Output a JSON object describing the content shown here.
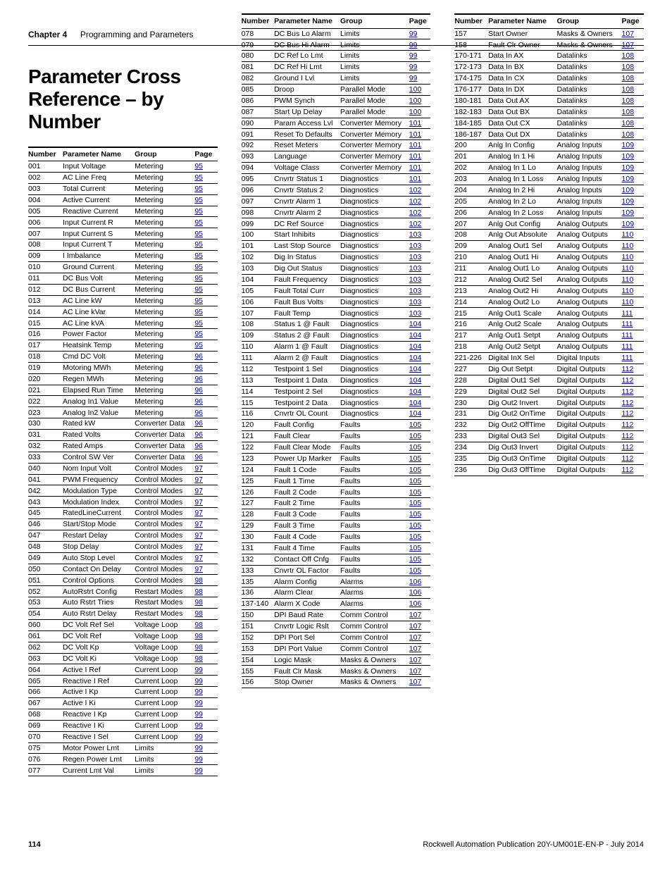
{
  "header": {
    "chapter_label": "Chapter 4",
    "chapter_title": "Programming and Parameters"
  },
  "page_title": "Parameter Cross Reference – by Number",
  "table_headers": [
    "Number",
    "Parameter Name",
    "Group",
    "Page"
  ],
  "columns": [
    [
      {
        "n": "001",
        "p": "Input Voltage",
        "g": "Metering",
        "pg": "95"
      },
      {
        "n": "002",
        "p": "AC Line Freq",
        "g": "Metering",
        "pg": "95"
      },
      {
        "n": "003",
        "p": "Total Current",
        "g": "Metering",
        "pg": "95"
      },
      {
        "n": "004",
        "p": "Active Current",
        "g": "Metering",
        "pg": "95"
      },
      {
        "n": "005",
        "p": "Reactive Current",
        "g": "Metering",
        "pg": "95"
      },
      {
        "n": "006",
        "p": "Input Current R",
        "g": "Metering",
        "pg": "95"
      },
      {
        "n": "007",
        "p": "Input Current S",
        "g": "Metering",
        "pg": "95"
      },
      {
        "n": "008",
        "p": "Input Current T",
        "g": "Metering",
        "pg": "95"
      },
      {
        "n": "009",
        "p": "I Imbalance",
        "g": "Metering",
        "pg": "95"
      },
      {
        "n": "010",
        "p": "Ground Current",
        "g": "Metering",
        "pg": "95"
      },
      {
        "n": "011",
        "p": "DC Bus Volt",
        "g": "Metering",
        "pg": "95"
      },
      {
        "n": "012",
        "p": "DC Bus Current",
        "g": "Metering",
        "pg": "95"
      },
      {
        "n": "013",
        "p": "AC Line kW",
        "g": "Metering",
        "pg": "95"
      },
      {
        "n": "014",
        "p": "AC Line kVar",
        "g": "Metering",
        "pg": "95"
      },
      {
        "n": "015",
        "p": "AC Line kVA",
        "g": "Metering",
        "pg": "95"
      },
      {
        "n": "016",
        "p": "Power Factor",
        "g": "Metering",
        "pg": "95"
      },
      {
        "n": "017",
        "p": "Heatsink Temp",
        "g": "Metering",
        "pg": "95"
      },
      {
        "n": "018",
        "p": "Cmd DC Volt",
        "g": "Metering",
        "pg": "96"
      },
      {
        "n": "019",
        "p": "Motoring MWh",
        "g": "Metering",
        "pg": "96"
      },
      {
        "n": "020",
        "p": "Regen MWh",
        "g": "Metering",
        "pg": "96"
      },
      {
        "n": "021",
        "p": "Elapsed Run Time",
        "g": "Metering",
        "pg": "96"
      },
      {
        "n": "022",
        "p": "Analog In1 Value",
        "g": "Metering",
        "pg": "96"
      },
      {
        "n": "023",
        "p": "Analog In2 Value",
        "g": "Metering",
        "pg": "96"
      },
      {
        "n": "030",
        "p": "Rated kW",
        "g": "Converter Data",
        "pg": "96"
      },
      {
        "n": "031",
        "p": "Rated Volts",
        "g": "Converter Data",
        "pg": "96"
      },
      {
        "n": "032",
        "p": "Rated Amps",
        "g": "Converter Data",
        "pg": "96"
      },
      {
        "n": "033",
        "p": "Control SW Ver",
        "g": "Converter Data",
        "pg": "96"
      },
      {
        "n": "040",
        "p": "Nom Input Volt",
        "g": "Control Modes",
        "pg": "97"
      },
      {
        "n": "041",
        "p": "PWM Frequency",
        "g": "Control Modes",
        "pg": "97"
      },
      {
        "n": "042",
        "p": "Modulation Type",
        "g": "Control Modes",
        "pg": "97"
      },
      {
        "n": "043",
        "p": "Modulation Index",
        "g": "Control Modes",
        "pg": "97"
      },
      {
        "n": "045",
        "p": "RatedLineCurrent",
        "g": "Control Modes",
        "pg": "97"
      },
      {
        "n": "046",
        "p": "Start/Stop Mode",
        "g": "Control Modes",
        "pg": "97"
      },
      {
        "n": "047",
        "p": "Restart Delay",
        "g": "Control Modes",
        "pg": "97"
      },
      {
        "n": "048",
        "p": "Stop Delay",
        "g": "Control Modes",
        "pg": "97"
      },
      {
        "n": "049",
        "p": "Auto Stop Level",
        "g": "Control Modes",
        "pg": "97"
      },
      {
        "n": "050",
        "p": "Contact On Delay",
        "g": "Control Modes",
        "pg": "97"
      },
      {
        "n": "051",
        "p": "Control Options",
        "g": "Control Modes",
        "pg": "98"
      },
      {
        "n": "052",
        "p": "AutoRstrt Config",
        "g": "Restart Modes",
        "pg": "98"
      },
      {
        "n": "053",
        "p": "Auto Rstrt Tries",
        "g": "Restart Modes",
        "pg": "98"
      },
      {
        "n": "054",
        "p": "Auto Rstrt Delay",
        "g": "Restart Modes",
        "pg": "98"
      },
      {
        "n": "060",
        "p": "DC Volt Ref Sel",
        "g": "Voltage Loop",
        "pg": "98"
      },
      {
        "n": "061",
        "p": "DC Volt Ref",
        "g": "Voltage Loop",
        "pg": "98"
      },
      {
        "n": "062",
        "p": "DC Volt Kp",
        "g": "Voltage Loop",
        "pg": "98"
      },
      {
        "n": "063",
        "p": "DC Volt Ki",
        "g": "Voltage Loop",
        "pg": "98"
      },
      {
        "n": "064",
        "p": "Active I Ref",
        "g": "Current Loop",
        "pg": "99"
      },
      {
        "n": "065",
        "p": "Reactive I Ref",
        "g": "Current Loop",
        "pg": "99"
      },
      {
        "n": "066",
        "p": "Active I Kp",
        "g": "Current Loop",
        "pg": "99"
      },
      {
        "n": "067",
        "p": "Active I Ki",
        "g": "Current Loop",
        "pg": "99"
      },
      {
        "n": "068",
        "p": "Reactive I Kp",
        "g": "Current Loop",
        "pg": "99"
      },
      {
        "n": "069",
        "p": "Reactive I Ki",
        "g": "Current Loop",
        "pg": "99"
      },
      {
        "n": "070",
        "p": "Reactive I Sel",
        "g": "Current Loop",
        "pg": "99"
      },
      {
        "n": "075",
        "p": "Motor Power Lmt",
        "g": "Limits",
        "pg": "99"
      },
      {
        "n": "076",
        "p": "Regen Power Lmt",
        "g": "Limits",
        "pg": "99"
      },
      {
        "n": "077",
        "p": "Current Lmt Val",
        "g": "Limits",
        "pg": "99"
      }
    ],
    [
      {
        "n": "078",
        "p": "DC Bus Lo Alarm",
        "g": "Limits",
        "pg": "99"
      },
      {
        "n": "079",
        "p": "DC Bus Hi Alarm",
        "g": "Limits",
        "pg": "99"
      },
      {
        "n": "080",
        "p": "DC Ref Lo Lmt",
        "g": "Limits",
        "pg": "99"
      },
      {
        "n": "081",
        "p": "DC Ref Hi Lmt",
        "g": "Limits",
        "pg": "99"
      },
      {
        "n": "082",
        "p": "Ground I Lvl",
        "g": "Limits",
        "pg": "99"
      },
      {
        "n": "085",
        "p": "Droop",
        "g": "Parallel Mode",
        "pg": "100"
      },
      {
        "n": "086",
        "p": "PWM Synch",
        "g": "Parallel Mode",
        "pg": "100"
      },
      {
        "n": "087",
        "p": "Start Up Delay",
        "g": "Parallel Mode",
        "pg": "100"
      },
      {
        "n": "090",
        "p": "Param Access Lvl",
        "g": "Converter Memory",
        "pg": "101"
      },
      {
        "n": "091",
        "p": "Reset To Defaults",
        "g": "Converter Memory",
        "pg": "101"
      },
      {
        "n": "092",
        "p": "Reset Meters",
        "g": "Converter Memory",
        "pg": "101"
      },
      {
        "n": "093",
        "p": "Language",
        "g": "Converter Memory",
        "pg": "101"
      },
      {
        "n": "094",
        "p": "Voltage Class",
        "g": "Converter Memory",
        "pg": "101"
      },
      {
        "n": "095",
        "p": "Cnvrtr Status 1",
        "g": "Diagnostics",
        "pg": "101"
      },
      {
        "n": "096",
        "p": "Cnvrtr Status 2",
        "g": "Diagnostics",
        "pg": "102"
      },
      {
        "n": "097",
        "p": "Cnvrtr Alarm 1",
        "g": "Diagnostics",
        "pg": "102"
      },
      {
        "n": "098",
        "p": "Cnvrtr Alarm 2",
        "g": "Diagnostics",
        "pg": "102"
      },
      {
        "n": "099",
        "p": "DC Ref Source",
        "g": "Diagnostics",
        "pg": "102"
      },
      {
        "n": "100",
        "p": "Start Inhibits",
        "g": "Diagnostics",
        "pg": "103"
      },
      {
        "n": "101",
        "p": "Last Stop Source",
        "g": "Diagnostics",
        "pg": "103"
      },
      {
        "n": "102",
        "p": "Dig In Status",
        "g": "Diagnostics",
        "pg": "103"
      },
      {
        "n": "103",
        "p": "Dig Out Status",
        "g": "Diagnostics",
        "pg": "103"
      },
      {
        "n": "104",
        "p": "Fault Frequency",
        "g": "Diagnostics",
        "pg": "103"
      },
      {
        "n": "105",
        "p": "Fault Total Curr",
        "g": "Diagnostics",
        "pg": "103"
      },
      {
        "n": "106",
        "p": "Fault Bus Volts",
        "g": "Diagnostics",
        "pg": "103"
      },
      {
        "n": "107",
        "p": "Fault Temp",
        "g": "Diagnostics",
        "pg": "103"
      },
      {
        "n": "108",
        "p": "Status 1 @ Fault",
        "g": "Diagnostics",
        "pg": "104"
      },
      {
        "n": "109",
        "p": "Status 2 @ Fault",
        "g": "Diagnostics",
        "pg": "104"
      },
      {
        "n": "110",
        "p": "Alarm 1 @ Fault",
        "g": "Diagnostics",
        "pg": "104"
      },
      {
        "n": "111",
        "p": "Alarm 2 @ Fault",
        "g": "Diagnostics",
        "pg": "104"
      },
      {
        "n": "112",
        "p": "Testpoint 1 Sel",
        "g": "Diagnostics",
        "pg": "104"
      },
      {
        "n": "113",
        "p": "Testpoint 1 Data",
        "g": "Diagnostics",
        "pg": "104"
      },
      {
        "n": "114",
        "p": "Testpoint 2 Sel",
        "g": "Diagnostics",
        "pg": "104"
      },
      {
        "n": "115",
        "p": "Testpoint 2 Data",
        "g": "Diagnostics",
        "pg": "104"
      },
      {
        "n": "116",
        "p": "Cnvrtr OL Count",
        "g": "Diagnostics",
        "pg": "104"
      },
      {
        "n": "120",
        "p": "Fault Config",
        "g": "Faults",
        "pg": "105"
      },
      {
        "n": "121",
        "p": "Fault Clear",
        "g": "Faults",
        "pg": "105"
      },
      {
        "n": "122",
        "p": "Fault Clear Mode",
        "g": "Faults",
        "pg": "105"
      },
      {
        "n": "123",
        "p": "Power Up Marker",
        "g": "Faults",
        "pg": "105"
      },
      {
        "n": "124",
        "p": "Fault 1 Code",
        "g": "Faults",
        "pg": "105"
      },
      {
        "n": "125",
        "p": "Fault 1 Time",
        "g": "Faults",
        "pg": "105"
      },
      {
        "n": "126",
        "p": "Fault 2 Code",
        "g": "Faults",
        "pg": "105"
      },
      {
        "n": "127",
        "p": "Fault 2 Time",
        "g": "Faults",
        "pg": "105"
      },
      {
        "n": "128",
        "p": "Fault 3 Code",
        "g": "Faults",
        "pg": "105"
      },
      {
        "n": "129",
        "p": "Fault 3 Time",
        "g": "Faults",
        "pg": "105"
      },
      {
        "n": "130",
        "p": "Fault 4 Code",
        "g": "Faults",
        "pg": "105"
      },
      {
        "n": "131",
        "p": "Fault 4 Time",
        "g": "Faults",
        "pg": "105"
      },
      {
        "n": "132",
        "p": "Contact Off Cnfg",
        "g": "Faults",
        "pg": "105"
      },
      {
        "n": "133",
        "p": "Cnvrtr OL Factor",
        "g": "Faults",
        "pg": "105"
      },
      {
        "n": "135",
        "p": "Alarm Config",
        "g": "Alarms",
        "pg": "106"
      },
      {
        "n": "136",
        "p": "Alarm Clear",
        "g": "Alarms",
        "pg": "106"
      },
      {
        "n": "137-140",
        "p": "Alarm X Code",
        "g": "Alarms",
        "pg": "106"
      },
      {
        "n": "150",
        "p": "DPI Baud Rate",
        "g": "Comm Control",
        "pg": "107"
      },
      {
        "n": "151",
        "p": "Cnvrtr Logic Rslt",
        "g": "Comm Control",
        "pg": "107"
      },
      {
        "n": "152",
        "p": "DPI Port Sel",
        "g": "Comm Control",
        "pg": "107"
      },
      {
        "n": "153",
        "p": "DPI Port Value",
        "g": "Comm Control",
        "pg": "107"
      },
      {
        "n": "154",
        "p": "Logic Mask",
        "g": "Masks & Owners",
        "pg": "107"
      },
      {
        "n": "155",
        "p": "Fault Clr Mask",
        "g": "Masks & Owners",
        "pg": "107"
      },
      {
        "n": "156",
        "p": "Stop Owner",
        "g": "Masks & Owners",
        "pg": "107"
      }
    ],
    [
      {
        "n": "157",
        "p": "Start Owner",
        "g": "Masks & Owners",
        "pg": "107"
      },
      {
        "n": "158",
        "p": "Fault Clr Owner",
        "g": "Masks & Owners",
        "pg": "107"
      },
      {
        "n": "170-171",
        "p": "Data In AX",
        "g": "Datalinks",
        "pg": "108"
      },
      {
        "n": "172-173",
        "p": "Data In BX",
        "g": "Datalinks",
        "pg": "108"
      },
      {
        "n": "174-175",
        "p": "Data In CX",
        "g": "Datalinks",
        "pg": "108"
      },
      {
        "n": "176-177",
        "p": "Data In DX",
        "g": "Datalinks",
        "pg": "108"
      },
      {
        "n": "180-181",
        "p": "Data Out AX",
        "g": "Datalinks",
        "pg": "108"
      },
      {
        "n": "182-183",
        "p": "Data Out BX",
        "g": "Datalinks",
        "pg": "108"
      },
      {
        "n": "184-185",
        "p": "Data Out CX",
        "g": "Datalinks",
        "pg": "108"
      },
      {
        "n": "186-187",
        "p": "Data Out DX",
        "g": "Datalinks",
        "pg": "108"
      },
      {
        "n": "200",
        "p": "Anlg In Config",
        "g": "Analog Inputs",
        "pg": "109"
      },
      {
        "n": "201",
        "p": "Analog In 1 Hi",
        "g": "Analog Inputs",
        "pg": "109"
      },
      {
        "n": "202",
        "p": "Analog In 1 Lo",
        "g": "Analog Inputs",
        "pg": "109"
      },
      {
        "n": "203",
        "p": "Analog In 1 Loss",
        "g": "Analog Inputs",
        "pg": "109"
      },
      {
        "n": "204",
        "p": "Analog In 2 Hi",
        "g": "Analog Inputs",
        "pg": "109"
      },
      {
        "n": "205",
        "p": "Analog In 2 Lo",
        "g": "Analog Inputs",
        "pg": "109"
      },
      {
        "n": "206",
        "p": "Analog In 2 Loss",
        "g": "Analog Inputs",
        "pg": "109"
      },
      {
        "n": "207",
        "p": "Anlg Out Config",
        "g": "Analog Outputs",
        "pg": "109"
      },
      {
        "n": "208",
        "p": "Anlg Out Absolute",
        "g": "Analog Outputs",
        "pg": "110"
      },
      {
        "n": "209",
        "p": "Analog Out1 Sel",
        "g": "Analog Outputs",
        "pg": "110"
      },
      {
        "n": "210",
        "p": "Analog Out1 Hi",
        "g": "Analog Outputs",
        "pg": "110"
      },
      {
        "n": "211",
        "p": "Analog Out1 Lo",
        "g": "Analog Outputs",
        "pg": "110"
      },
      {
        "n": "212",
        "p": "Analog Out2 Sel",
        "g": "Analog Outputs",
        "pg": "110"
      },
      {
        "n": "213",
        "p": "Analog Out2 Hi",
        "g": "Analog Outputs",
        "pg": "110"
      },
      {
        "n": "214",
        "p": "Analog Out2 Lo",
        "g": "Analog Outputs",
        "pg": "110"
      },
      {
        "n": "215",
        "p": "Anlg Out1 Scale",
        "g": "Analog Outputs",
        "pg": "111"
      },
      {
        "n": "216",
        "p": "Anlg Out2 Scale",
        "g": "Analog Outputs",
        "pg": "111"
      },
      {
        "n": "217",
        "p": "Anlg Out1 Setpt",
        "g": "Analog Outputs",
        "pg": "111"
      },
      {
        "n": "218",
        "p": "Anlg Out2 Setpt",
        "g": "Analog Outputs",
        "pg": "111"
      },
      {
        "n": "221-226",
        "p": "Digital InX Sel",
        "g": "Digital Inputs",
        "pg": "111"
      },
      {
        "n": "227",
        "p": "Dig Out Setpt",
        "g": "Digital Outputs",
        "pg": "112"
      },
      {
        "n": "228",
        "p": "Digital Out1 Sel",
        "g": "Digital Outputs",
        "pg": "112"
      },
      {
        "n": "229",
        "p": "Digital Out2 Sel",
        "g": "Digital Outputs",
        "pg": "112"
      },
      {
        "n": "230",
        "p": "Dig Out2 Invert",
        "g": "Digital Outputs",
        "pg": "112"
      },
      {
        "n": "231",
        "p": "Dig Out2 OnTime",
        "g": "Digital Outputs",
        "pg": "112"
      },
      {
        "n": "232",
        "p": "Dig Out2 OffTime",
        "g": "Digital Outputs",
        "pg": "112"
      },
      {
        "n": "233",
        "p": "Digital Out3 Sel",
        "g": "Digital Outputs",
        "pg": "112"
      },
      {
        "n": "234",
        "p": "Dig Out3 Invert",
        "g": "Digital Outputs",
        "pg": "112"
      },
      {
        "n": "235",
        "p": "Dig Out3 OnTime",
        "g": "Digital Outputs",
        "pg": "112"
      },
      {
        "n": "236",
        "p": "Dig Out3 OffTime",
        "g": "Digital Outputs",
        "pg": "112"
      }
    ]
  ],
  "footer": {
    "page_number": "114",
    "publication": "Rockwell Automation Publication 20Y-UM001E-EN-P - July 2014"
  }
}
